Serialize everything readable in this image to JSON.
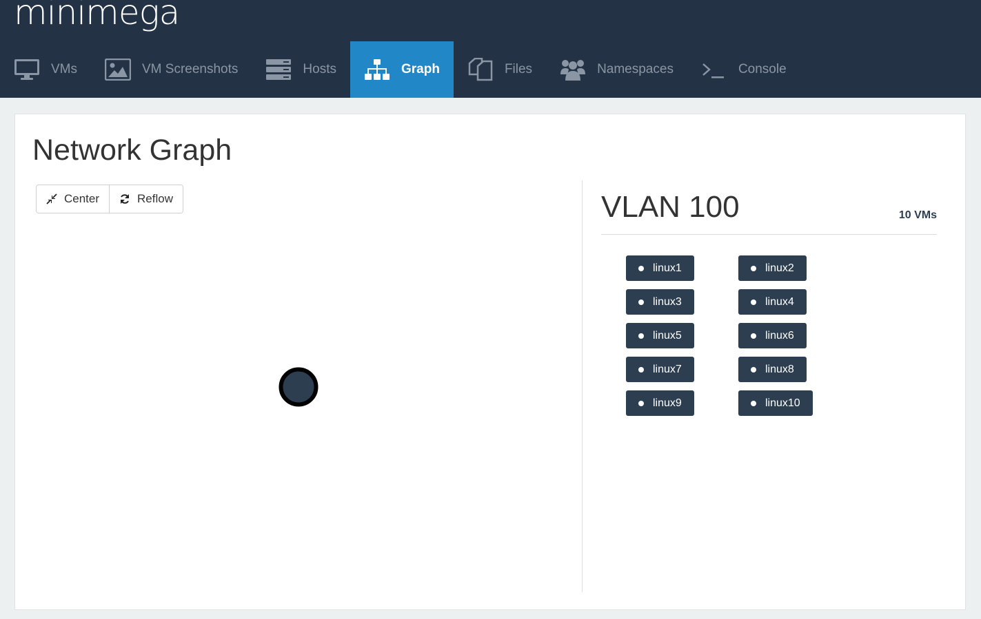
{
  "app": {
    "logo": "minimega"
  },
  "nav": [
    {
      "label": "VMs",
      "icon": "monitor-icon",
      "active": false
    },
    {
      "label": "VM Screenshots",
      "icon": "image-icon",
      "active": false
    },
    {
      "label": "Hosts",
      "icon": "server-icon",
      "active": false
    },
    {
      "label": "Graph",
      "icon": "sitemap-icon",
      "active": true
    },
    {
      "label": "Files",
      "icon": "files-icon",
      "active": false
    },
    {
      "label": "Namespaces",
      "icon": "users-icon",
      "active": false
    },
    {
      "label": "Console",
      "icon": "terminal-icon",
      "active": false
    }
  ],
  "page": {
    "title": "Network Graph"
  },
  "toolbar": {
    "center_label": "Center",
    "reflow_label": "Reflow"
  },
  "detail": {
    "vlan_title": "VLAN 100",
    "vm_count": "10 VMs",
    "vms": [
      "linux1",
      "linux2",
      "linux3",
      "linux4",
      "linux5",
      "linux6",
      "linux7",
      "linux8",
      "linux9",
      "linux10"
    ]
  },
  "colors": {
    "header_bg": "#233245",
    "active_tab": "#2187c7",
    "vm_pill": "#2c3e50",
    "graph_node_fill": "#2c3e50",
    "graph_node_stroke": "#000000"
  }
}
